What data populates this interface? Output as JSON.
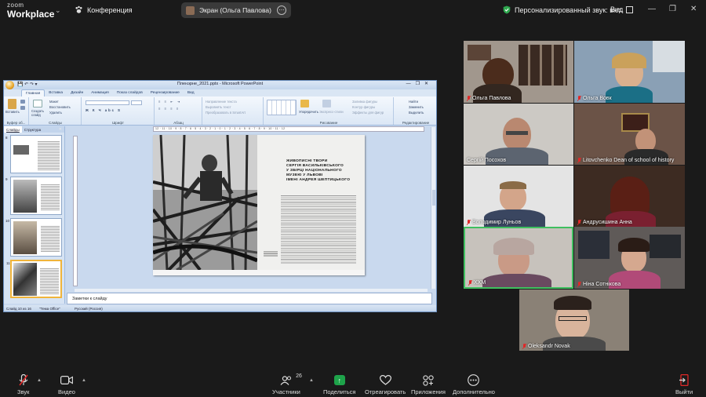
{
  "topbar": {
    "logo_small": "zoom",
    "logo_big": "Workplace",
    "conference_label": "Конференция",
    "screen_share_label": "Экран (Ольга Павлова)",
    "audio_status": "Персонализированный звук: вкл.",
    "view_label": "Вид"
  },
  "ppt": {
    "window_title": "Пленэрне_2021.pptx - Microsoft PowerPoint",
    "tabs": [
      "Главная",
      "Вставка",
      "Дизайн",
      "Анимация",
      "Показ слайдов",
      "Рецензирование",
      "Вид"
    ],
    "groups": [
      "Буфер об...",
      "Слайды",
      "Шрифт",
      "Абзац",
      "Рисование",
      "Редактирование"
    ],
    "ribbon_items": {
      "paste": "Вставить",
      "create_slide": "Создать слайд",
      "layout": "Макет",
      "restore": "Восстановить",
      "delete": "Удалить",
      "text_direction": "Направление текста",
      "align_text": "Выровнять текст",
      "convert_smartart": "Преобразовать в SmartArt",
      "arrange": "Упорядочить",
      "quick_styles": "Экспресс-стили",
      "shape_fill": "Заливка фигуры",
      "shape_outline": "Контур фигуры",
      "shape_effects": "Эффекты для фигур",
      "find": "Найти",
      "replace": "Заменить",
      "select": "Выделить"
    },
    "panel_tabs": [
      "Слайды",
      "Структура"
    ],
    "slide_numbers": [
      "8",
      "9",
      "10",
      "11"
    ],
    "ruler_text": "12 · 11 · 10 · 9 · 8 · 7 · 6 · 5 · 4 · 3 · 2 · 1 · 0 · 1 · 2 · 3 · 4 · 5 · 6 · 7 · 8 · 9 · 10 · 11 · 12",
    "book_title": "ЖИВОПИСНІ ТВОРИ\nСЕРГІЯ ВАСИЛЬКІВСЬКОГО\nУ ЗБІРЦІ НАЦІОНАЛЬНОГО\nМУЗЕЮ У ЛЬВОВІ\nІМЕНІ АНДРЕЯ ШЕПТИЦЬКОГО",
    "notes_placeholder": "Заметки к слайду",
    "status_slide": "Слайд 10 из 16",
    "status_theme": "\"Тема Office\"",
    "status_lang": "Русский (Россия)"
  },
  "participants": [
    {
      "name": "Ольга Павлова",
      "muted": true
    },
    {
      "name": "Ольга Вовк",
      "muted": true
    },
    {
      "name": "Сергій Посохов",
      "muted": false
    },
    {
      "name": "Litovchenko Dean of school of history",
      "muted": true
    },
    {
      "name": "Володимир Луньов",
      "muted": true
    },
    {
      "name": "Андрусишина Анна",
      "muted": true
    },
    {
      "name": "ХХМ",
      "muted": true
    },
    {
      "name": "Ніна Сотнікова",
      "muted": true
    },
    {
      "name": "Oleksandr Novak",
      "muted": true
    }
  ],
  "toolbar": {
    "audio": "Звук",
    "video": "Видео",
    "participants": "Участники",
    "participants_count": "26",
    "share": "Поделиться",
    "react": "Отреагировать",
    "apps": "Приложения",
    "more": "Дополнительно",
    "leave": "Выйти"
  },
  "colors": {
    "speaking_border": "#3fbf5f",
    "share_green": "#1ea34a",
    "leave_red": "#e02828",
    "mute_red": "#e02828"
  }
}
